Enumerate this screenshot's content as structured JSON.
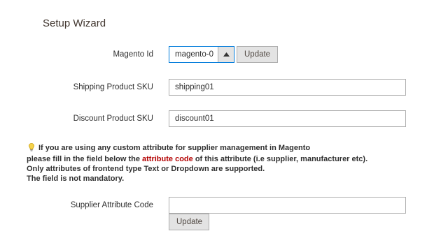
{
  "wizard": {
    "title": "Setup Wizard",
    "magento_id": {
      "label": "Magento Id",
      "value": "magento-0",
      "update_label": "Update"
    },
    "shipping_sku": {
      "label": "Shipping Product SKU",
      "value": "shipping01"
    },
    "discount_sku": {
      "label": "Discount Product SKU",
      "value": "discount01"
    },
    "note": {
      "line1": "If you are using any custom attribute for supplier management in Magento",
      "line2_pre": "please fill in the field below the ",
      "line2_highlight": "attribute code",
      "line2_post": " of this attribute (i.e supplier, manufacturer etc).",
      "line3": "Only attributes of frontend type Text or Dropdown are supported.",
      "line4": "The field is not mandatory.",
      "highlight_color": "#b30000"
    },
    "supplier_attribute": {
      "label": "Supplier Attribute Code",
      "value": "",
      "update_label": "Update"
    }
  }
}
